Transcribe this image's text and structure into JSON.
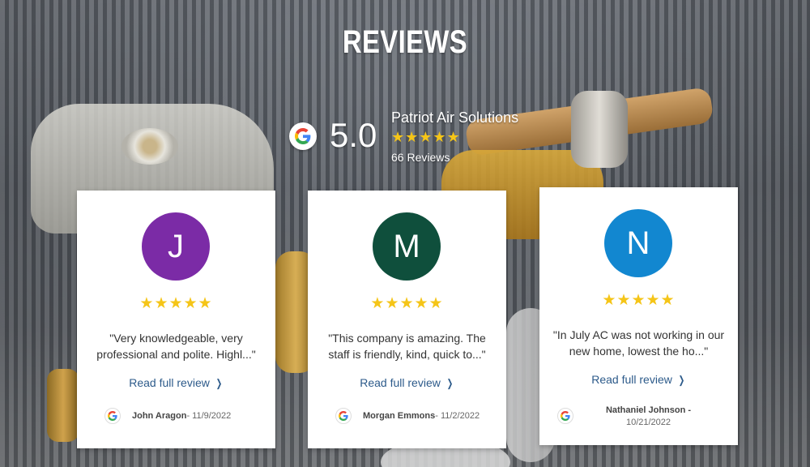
{
  "section_title": "REVIEWS",
  "summary": {
    "rating": "5.0",
    "business_name": "Patriot Air Solutions",
    "stars": "★★★★★",
    "review_count": "66 Reviews",
    "rating_value": 5.0
  },
  "reviews": [
    {
      "initial": "J",
      "avatar_color": "#7b2ba6",
      "stars": "★★★★★",
      "rating_value": 5,
      "text": "\"Very knowledgeable, very professional and polite. Highl...\"",
      "read_more": "Read full review",
      "reviewer": "John Aragon",
      "date": " - 11/9/2022"
    },
    {
      "initial": "M",
      "avatar_color": "#0f4f3c",
      "stars": "★★★★★",
      "rating_value": 5,
      "text": "\"This company is amazing. The staff is friendly, kind, quick to...\"",
      "read_more": "Read full review",
      "reviewer": "Morgan Emmons",
      "date": " - 11/2/2022"
    },
    {
      "initial": "N",
      "avatar_color": "#1287d0",
      "stars": "★★★★★",
      "rating_value": 5,
      "text": "\"In July AC was not working in our new home, lowest the ho...\"",
      "read_more": "Read full review",
      "reviewer": "Nathaniel Johnson -",
      "date": "10/21/2022"
    }
  ],
  "colors": {
    "star": "#f5c518",
    "link": "#2c5a8a"
  }
}
